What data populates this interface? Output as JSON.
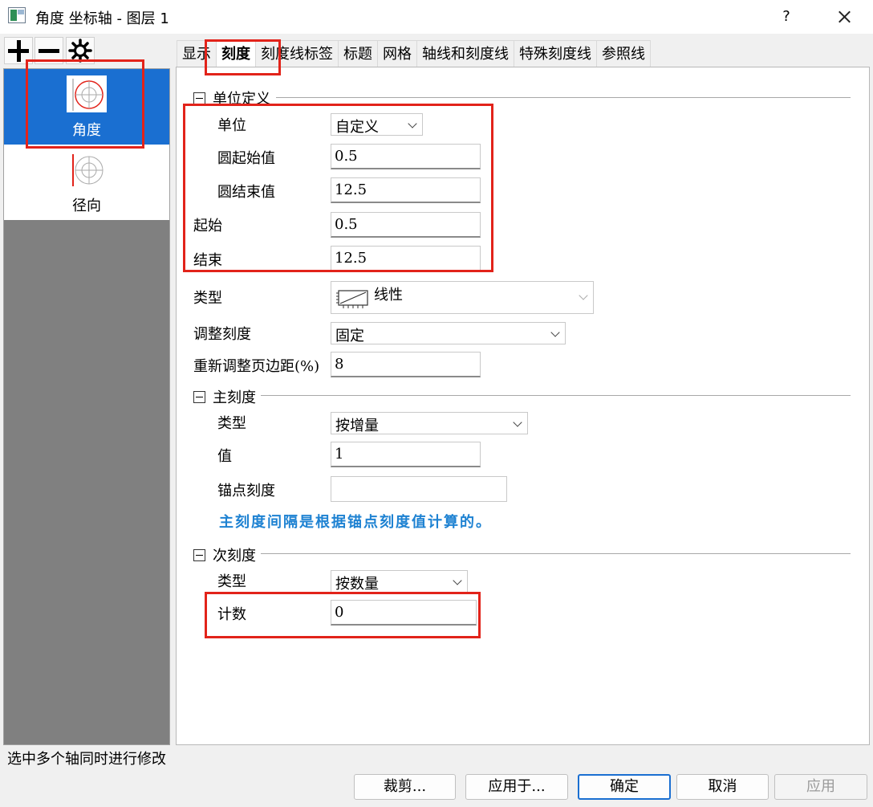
{
  "window": {
    "title": "角度 坐标轴 - 图层 1",
    "help": "?"
  },
  "toolbar": {
    "add_icon": "plus-icon",
    "remove_icon": "minus-icon",
    "settings_icon": "gear-icon"
  },
  "axes": [
    {
      "label": "角度",
      "selected": true,
      "icon": "polar-angle-axis-icon"
    },
    {
      "label": "径向",
      "selected": false,
      "icon": "polar-radial-axis-icon"
    }
  ],
  "tabs": [
    "显示",
    "刻度",
    "刻度线标签",
    "标题",
    "网格",
    "轴线和刻度线",
    "特殊刻度线",
    "参照线"
  ],
  "active_tab": "刻度",
  "unit_section": {
    "title": "单位定义",
    "unit_label": "单位",
    "unit_value": "自定义",
    "circle_start_label": "圆起始值",
    "circle_start_value": "0.5",
    "circle_end_label": "圆结束值",
    "circle_end_value": "12.5",
    "start_label": "起始",
    "start_value": "0.5",
    "end_label": "结束",
    "end_value": "12.5"
  },
  "type_label": "类型",
  "type_value": "线性",
  "type_icon": "linear-scale-icon",
  "rescale_label": "调整刻度",
  "rescale_value": "固定",
  "margin_label": "重新调整页边距(%)",
  "margin_value": "8",
  "major_section": {
    "title": "主刻度",
    "type_label": "类型",
    "type_value": "按增量",
    "value_label": "值",
    "value_value": "1",
    "anchor_label": "锚点刻度",
    "anchor_value": "",
    "info": "主刻度间隔是根据锚点刻度值计算的。"
  },
  "minor_section": {
    "title": "次刻度",
    "type_label": "类型",
    "type_value": "按数量",
    "count_label": "计数",
    "count_value": "0"
  },
  "status_text": "选中多个轴同时进行修改",
  "buttons": {
    "crop": "裁剪...",
    "apply_to": "应用于...",
    "ok": "确定",
    "cancel": "取消",
    "apply": "应用"
  },
  "colors": {
    "selection": "#1a6fd1",
    "highlight_box": "#e2231a",
    "info_text": "#1e82d2"
  }
}
